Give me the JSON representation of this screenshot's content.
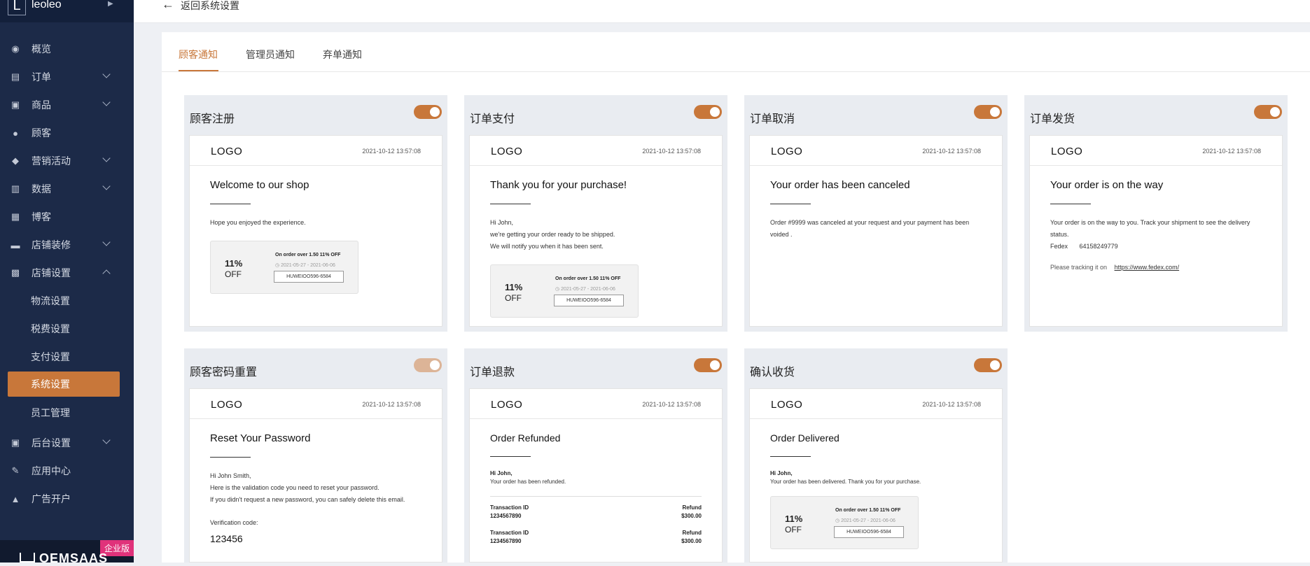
{
  "brand": {
    "initial": "L",
    "name": "leoleo"
  },
  "sidebar": {
    "items": [
      {
        "label": "概览",
        "icon": "compass-icon"
      },
      {
        "label": "订单",
        "icon": "clipboard-icon",
        "expandable": true
      },
      {
        "label": "商品",
        "icon": "box-icon",
        "expandable": true
      },
      {
        "label": "顾客",
        "icon": "user-icon"
      },
      {
        "label": "营销活动",
        "icon": "tag-icon",
        "expandable": true
      },
      {
        "label": "数据",
        "icon": "bar-chart-icon",
        "expandable": true
      },
      {
        "label": "博客",
        "icon": "document-icon"
      },
      {
        "label": "店铺装修",
        "icon": "paint-roller-icon",
        "expandable": true
      },
      {
        "label": "店铺设置",
        "icon": "store-icon",
        "expanded": true
      }
    ],
    "sub_items": [
      {
        "label": "物流设置"
      },
      {
        "label": "税费设置"
      },
      {
        "label": "支付设置"
      },
      {
        "label": "系统设置",
        "active": true
      },
      {
        "label": "员工管理"
      }
    ],
    "lower_items": [
      {
        "label": "后台设置",
        "icon": "settings-panel-icon",
        "expandable": true
      },
      {
        "label": "应用中心",
        "icon": "wrench-icon"
      },
      {
        "label": "广告开户",
        "icon": "ad-icon"
      }
    ],
    "enterprise_badge": "企业版",
    "bottom_brand": "OEMSAAS"
  },
  "header": {
    "back_label": "返回系统设置"
  },
  "tabs": [
    {
      "label": "顾客通知",
      "active": true
    },
    {
      "label": "管理员通知"
    },
    {
      "label": "弃单通知"
    }
  ],
  "cards": {
    "register": {
      "title": "顾客注册",
      "enabled": true,
      "logo": "LOGO",
      "date": "2021-10-12 13:57:08",
      "headline": "Welcome to our shop",
      "lines": [
        "Hope you enjoyed the experience."
      ],
      "coupon": {
        "pct": "11%",
        "off": "OFF",
        "rule": "On order over  1.50 11% OFF",
        "dates": "2021-05-27 - 2021-06-06",
        "code": "HUWEIOO596-6584"
      }
    },
    "payment": {
      "title": "订单支付",
      "enabled": true,
      "logo": "LOGO",
      "date": "2021-10-12 13:57:08",
      "headline": "Thank you for your purchase!",
      "lines": [
        "Hi John,",
        "we're getting your order ready to be shipped.",
        "We will notify you when it has been sent."
      ],
      "coupon": {
        "pct": "11%",
        "off": "OFF",
        "rule": "On order over  1.50 11% OFF",
        "dates": "2021-05-27 - 2021-06-06",
        "code": "HUWEIOO596-6584"
      }
    },
    "cancel": {
      "title": "订单取消",
      "enabled": true,
      "logo": "LOGO",
      "date": "2021-10-12 13:57:08",
      "headline": "Your order has been canceled",
      "lines": [
        "Order #9999 was canceled at your request and your payment has been voided ."
      ]
    },
    "shipping": {
      "title": "订单发货",
      "enabled": true,
      "logo": "LOGO",
      "date": "2021-10-12 13:57:08",
      "headline": "Your order is on the way",
      "lines": [
        "Your order is on the way to you. Track your shipment to see the delivery status."
      ],
      "carrier": "Fedex",
      "tracking_no": "64158249779",
      "tracking_prefix": "Please tracking it on",
      "tracking_link": "https://www.fedex.com/"
    },
    "password": {
      "title": "顾客密码重置",
      "enabled": true,
      "logo": "LOGO",
      "date": "2021-10-12 13:57:08",
      "headline": "Reset Your Password",
      "lines": [
        "Hi John Smith,",
        "Here is the validation code you need to reset your password.",
        "If you didn't request a new password, you can safely delete this email."
      ],
      "code_label": "Verification code:",
      "code": "123456"
    },
    "refund": {
      "title": "订单退款",
      "enabled": true,
      "logo": "LOGO",
      "date": "2021-10-12 13:57:08",
      "headline": "Order Refunded",
      "greeting": "Hi John,",
      "message": "Your order has been refunded.",
      "rows": [
        {
          "id_label": "Transaction ID",
          "id": "1234567890",
          "amount_label": "Refund",
          "amount": "$300.00"
        },
        {
          "id_label": "Transaction ID",
          "id": "1234567890",
          "amount_label": "Refund",
          "amount": "$300.00"
        }
      ]
    },
    "delivered": {
      "title": "确认收货",
      "enabled": true,
      "logo": "LOGO",
      "date": "2021-10-12 13:57:08",
      "headline": "Order Delivered",
      "greeting": "Hi John,",
      "message": "Your order has been delivered. Thank you for your purchase.",
      "coupon": {
        "pct": "11%",
        "off": "OFF",
        "rule": "On order over  1.50 11% OFF",
        "dates": "2021-05-27 - 2021-06-06",
        "code": "HUWEIOO596-6584"
      }
    }
  },
  "colors": {
    "accent": "#c8773a",
    "sidebar_bg": "#1c2a48",
    "badge": "#e0327a"
  }
}
